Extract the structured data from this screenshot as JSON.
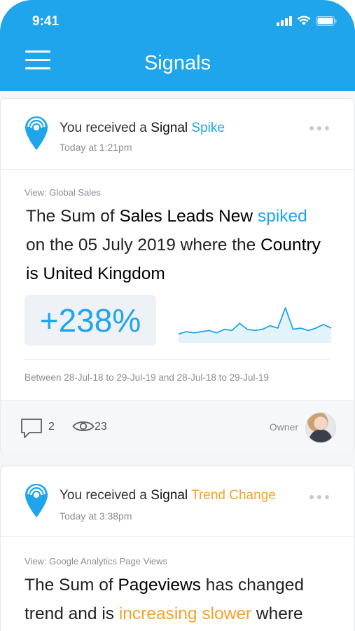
{
  "status_bar": {
    "time": "9:41"
  },
  "header": {
    "title": "Signals"
  },
  "signals": [
    {
      "received_prefix": "You received a ",
      "signal_word": "Signal",
      "signal_type": "Spike",
      "time": "Today at 1:21pm",
      "view": "View: Global Sales",
      "line1_pre": "The Sum of ",
      "line1_measure": "Sales Leads New",
      "line1_post": " ",
      "line1_highlight": "spiked",
      "line2_pre": "on the 05 July 2019 where the ",
      "line2_dimension": "Country",
      "line3": "is United Kingdom",
      "metric": "+238%",
      "date_range": "Between 28-Jul-18 to 29-Jul-19 and 28-Jul-18 to 29-Jul-19",
      "comments": "2",
      "views": "23",
      "owner_label": "Owner",
      "sparkline": [
        5,
        7,
        6,
        7,
        8,
        6,
        9,
        8,
        14,
        9,
        8,
        9,
        12,
        10,
        27,
        9,
        10,
        8,
        10,
        13,
        10
      ]
    },
    {
      "received_prefix": "You received a ",
      "signal_word": "Signal",
      "signal_type": "Trend Change",
      "time": "Today at 3:38pm",
      "view": "View: Google Analytics Page Views",
      "line1_pre": "The Sum of ",
      "line1_measure": "Pageviews",
      "line1_post": " has changed",
      "line2_pre": "trend and is ",
      "line2_highlight": "increasing slower",
      "line2_post": " where"
    }
  ],
  "colors": {
    "brand_blue": "#1ea5ec",
    "trend_orange": "#f5a32a"
  },
  "icons": [
    "menu-icon",
    "location-pin-icon",
    "more-dots-icon",
    "comment-icon",
    "eye-icon",
    "signal-bars-icon",
    "wifi-icon",
    "battery-icon"
  ]
}
